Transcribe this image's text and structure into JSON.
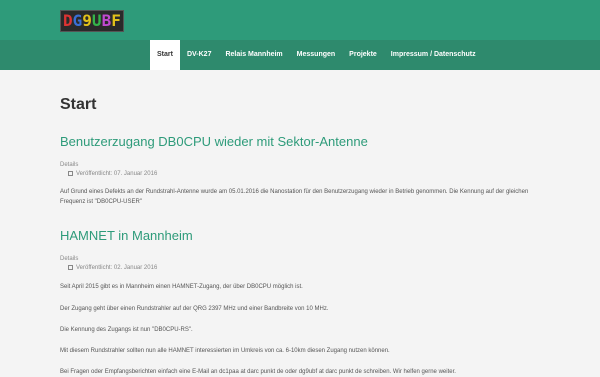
{
  "site": {
    "logo_text": "DG9UBF",
    "logo_sub": "______ ______"
  },
  "nav": {
    "items": [
      {
        "label": "Start"
      },
      {
        "label": "DV-K27"
      },
      {
        "label": "Relais Mannheim"
      },
      {
        "label": "Messungen"
      },
      {
        "label": "Projekte"
      },
      {
        "label": "Impressum / Datenschutz"
      }
    ],
    "active_index": 0
  },
  "page": {
    "title": "Start"
  },
  "articles": [
    {
      "title": "Benutzerzugang DB0CPU wieder mit Sektor-Antenne",
      "details_label": "Details",
      "published": "Veröffentlicht: 07. Januar 2016",
      "paragraphs": [
        "Auf Grund eines Defekts an der Rundstrahl-Antenne wurde am 05.01.2016 die Nanostation für den Benutzerzugang wieder in Betrieb genommen. Die Kennung auf der gleichen Frequenz ist \"DB0CPU-USER\""
      ]
    },
    {
      "title": "HAMNET in Mannheim",
      "details_label": "Details",
      "published": "Veröffentlicht: 02. Januar 2016",
      "paragraphs": [
        "Seit April 2015 gibt es in Mannheim einen HAMNET-Zugang, der über DB0CPU möglich ist.",
        "Der Zugang geht über einen Rundstrahler auf der QRG 2397 MHz und einer Bandbreite von 10 MHz.",
        "Die Kennung des Zugangs ist nun \"DB0CPU-RS\".",
        "Mit diesem Rundstrahler sollten nun alle HAMNET interessierten im Umkreis von ca. 6-10km diesen Zugang nutzen können.",
        "Bei Fragen oder Empfangsberichten einfach eine E-Mail an dc1paa at darc punkt de oder dg9ubf at darc punkt de schreiben. Wir helfen gerne weiter."
      ]
    }
  ]
}
